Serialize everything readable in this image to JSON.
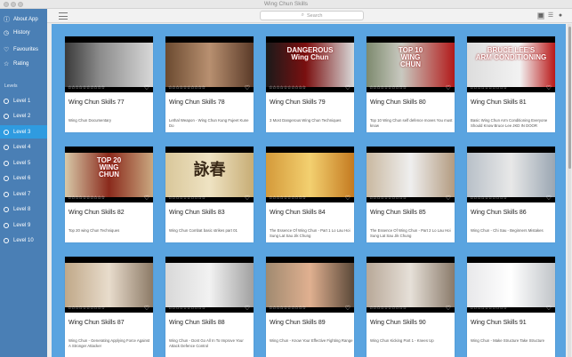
{
  "window": {
    "title": "Wing Chun Skills"
  },
  "sidebar": {
    "items": [
      {
        "label": "About App",
        "icon": "info-icon"
      },
      {
        "label": "History",
        "icon": "clock-icon"
      },
      {
        "label": "Favourites",
        "icon": "heart-icon"
      },
      {
        "label": "Rating",
        "icon": "star-icon"
      }
    ],
    "levels_header": "Levels",
    "levels": [
      "Level 1",
      "Level 2",
      "Level 3",
      "Level 4",
      "Level 5",
      "Level 6",
      "Level 7",
      "Level 8",
      "Level 9",
      "Level 10"
    ],
    "active_level_index": 2
  },
  "toolbar": {
    "search_placeholder": "Search",
    "icons": [
      "menu-icon",
      "search-icon",
      "grid-view-icon",
      "list-view-icon",
      "settings-icon"
    ]
  },
  "colors": {
    "sidebar": "#4a7fb5",
    "active": "#2f9be0",
    "content_bg": "#5aa4e0"
  },
  "videos": [
    {
      "title": "Wing Chun Skills 77",
      "desc": "Wing Chun Documentary",
      "rating": "☆☆☆☆☆☆☆☆☆☆"
    },
    {
      "title": "Wing Chun Skills 78",
      "desc": "Lethal Weapon - Wing Chun Kung Fujeet Kune Do",
      "rating": "☆☆☆☆☆☆☆☆☆☆"
    },
    {
      "title": "Wing Chun Skills 79",
      "desc": "3 Most Dangerous Wing Chun Techniques",
      "rating": "☆☆☆☆☆☆☆☆☆☆",
      "overlay": "DANGEROUS\nWing Chun"
    },
    {
      "title": "Wing Chun Skills 80",
      "desc": "Top 10 Wing Chun self defence moves You must know",
      "rating": "☆☆☆☆☆☆☆☆☆☆",
      "overlay": "TOP 10\nWING\nCHUN"
    },
    {
      "title": "Wing Chun Skills 81",
      "desc": "Basic Wing Chun Arm Conditioning Everyone Should Know Bruce Lee JKD IN DOOR",
      "rating": "☆☆☆☆☆☆☆☆☆☆",
      "overlay": "BRUCE LEE'S\nARM CONDITIONING"
    },
    {
      "title": "Wing Chun Skills 82",
      "desc": "Top 20 wing Chun Techniques",
      "rating": "☆☆☆☆☆☆☆☆☆☆",
      "overlay": "TOP 20\nWING\nCHUN"
    },
    {
      "title": "Wing Chun Skills 83",
      "desc": "Wing Chun Combat basic strikes part 01",
      "rating": "☆☆☆☆☆☆☆☆☆☆",
      "overlay": "詠春"
    },
    {
      "title": "Wing Chun Skills 84",
      "desc": "The Essence Of Wing Chun - Part 1 Lo Lau Hoi Sung Lat Sau Jik Chung",
      "rating": "☆☆☆☆☆☆☆☆☆☆"
    },
    {
      "title": "Wing Chun Skills 85",
      "desc": "The Essence Of Wing Chun - Part 2 Lo Lau Hoi Sung Lat Sau Jik Chung",
      "rating": "☆☆☆☆☆☆☆☆☆☆"
    },
    {
      "title": "Wing Chun Skills 86",
      "desc": "Wing Chun - Chi Sau - Beginners Mistakes",
      "rating": "☆☆☆☆☆☆☆☆☆☆"
    },
    {
      "title": "Wing Chun Skills 87",
      "desc": "Wing Chun - Generating Applying Force Against A Stronger Attacker",
      "rating": "☆☆☆☆☆☆☆☆☆☆"
    },
    {
      "title": "Wing Chun Skills 88",
      "desc": "Wing Chun - Dont Go All In To Improve Your Attack Defence Control",
      "rating": "☆☆☆☆☆☆☆☆☆☆"
    },
    {
      "title": "Wing Chun Skills 89",
      "desc": "Wing Chun - Know Your Effective Fighting Range",
      "rating": "☆☆☆☆☆☆☆☆☆☆"
    },
    {
      "title": "Wing Chun Skills 90",
      "desc": "Wing Chun Kicking Part 1 - Knees Up",
      "rating": "☆☆☆☆☆☆☆☆☆☆"
    },
    {
      "title": "Wing Chun Skills 91",
      "desc": "Wing Chun - Make Structure Take Structure",
      "rating": "☆☆☆☆☆☆☆☆☆☆"
    }
  ]
}
